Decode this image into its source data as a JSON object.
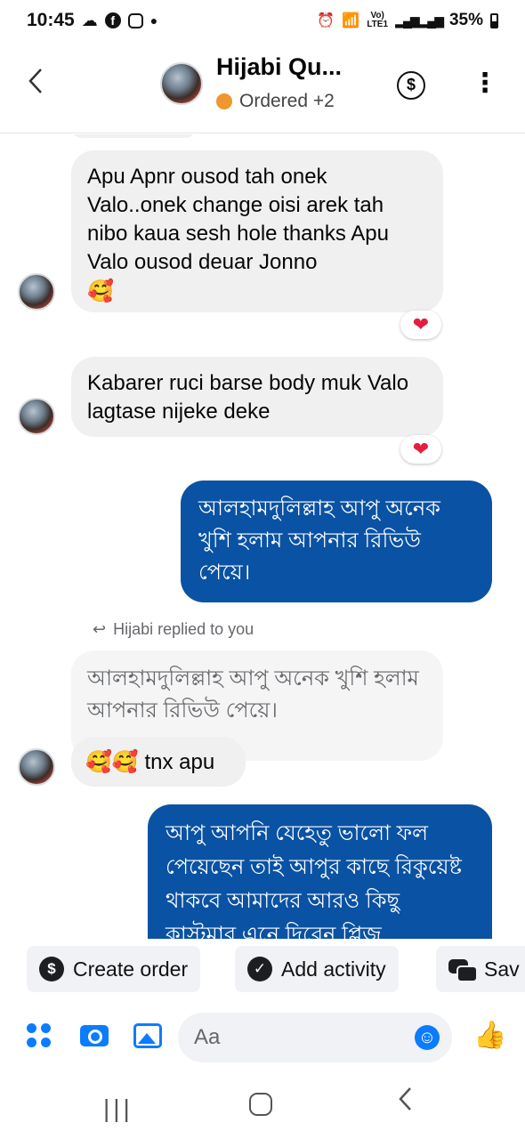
{
  "status_bar": {
    "time": "10:45",
    "icons_left": [
      "cloud-icon",
      "facebook-icon",
      "instagram-icon"
    ],
    "lte_label": "Vo) LTE1",
    "battery": "35%"
  },
  "header": {
    "title": "Hijabi Qu...",
    "subtitle": "Ordered +2",
    "status_color": "#f0962e"
  },
  "messages": [
    {
      "direction": "in",
      "text": "Apu Apnr ousod tah onek Valo..onek change oisi arek tah nibo kaua sesh hole thanks Apu Valo ousod deuar Jonno",
      "emoji": "🥰",
      "reaction": "❤"
    },
    {
      "direction": "in",
      "text": "Kabarer ruci barse body muk Valo lagtase nijeke deke",
      "reaction": "❤"
    },
    {
      "direction": "out",
      "text": "আলহামদুলিল্লাহ আপু অনেক খুশি হলাম আপনার রিভিউ পেয়ে।"
    },
    {
      "direction": "in",
      "reply_label": "Hijabi replied to you",
      "quoted": "আলহামদুলিল্লাহ আপু অনেক খুশি হলাম আপনার রিভিউ পেয়ে।",
      "emoji": "🥰🥰",
      "text": "tnx apu"
    },
    {
      "direction": "out",
      "text": "আপু আপনি যেহেতু ভালো ফল পেয়েছেন তাই আপুর কাছে রিকুয়েষ্ট থাকবে আমাদের আরও কিছু কাস্টমার এনে দিবেন প্লিজ"
    }
  ],
  "actions": {
    "create_order": "Create order",
    "add_activity": "Add activity",
    "save": "Sav"
  },
  "composer": {
    "placeholder": "Aa"
  },
  "colors": {
    "outgoing_bubble": "#0a52a3",
    "incoming_bubble": "#f0f0f0",
    "accent": "#0a7cff",
    "reaction": "#e41e3f"
  }
}
